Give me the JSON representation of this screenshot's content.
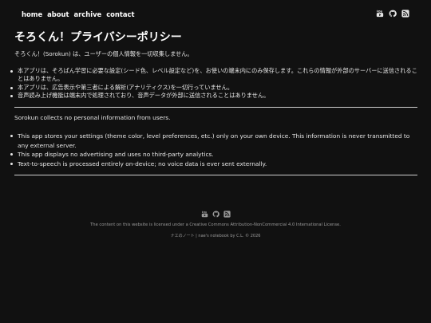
{
  "nav": {
    "links": [
      "home",
      "about",
      "archive",
      "contact"
    ],
    "icons": [
      "youtube-icon",
      "github-icon",
      "rss-icon"
    ]
  },
  "page": {
    "title": "そろくん！プライバシーポリシー",
    "ja_intro": "そろくん！(Sorokun) は、ユーザーの個人情報を一切収集しません。",
    "ja_items": [
      "本アプリは、そろばん学習に必要な設定(シード色、レベル設定など)を、お使いの端末内にのみ保存します。これらの情報が外部のサーバーに送信されることはありません。",
      "本アプリは、広告表示や第三者による解析(アナリティクス)を一切行っていません。",
      "音声読み上げ機能は端末内で処理されており、音声データが外部に送信されることはありません。"
    ],
    "en_intro": "Sorokun collects no personal information from users.",
    "en_items": [
      "This app stores your settings (theme color, level preferences, etc.) only on your own device. This information is never transmitted to any external server.",
      "This app displays no advertising and uses no third-party analytics.",
      "Text-to-speech is processed entirely on-device; no voice data is ever sent externally."
    ]
  },
  "footer": {
    "icons": [
      "youtube-icon",
      "github-icon",
      "rss-icon"
    ],
    "license": "The content on this website is licensed under a Creative Commons Attribution-NonCommercial 4.0 International License.",
    "copyright": "ナエのノート | nae's notebook by C.L. © 2026"
  },
  "colors": {
    "background": "#111111",
    "text": "#e6e6e6",
    "muted": "#9a9a9a"
  }
}
